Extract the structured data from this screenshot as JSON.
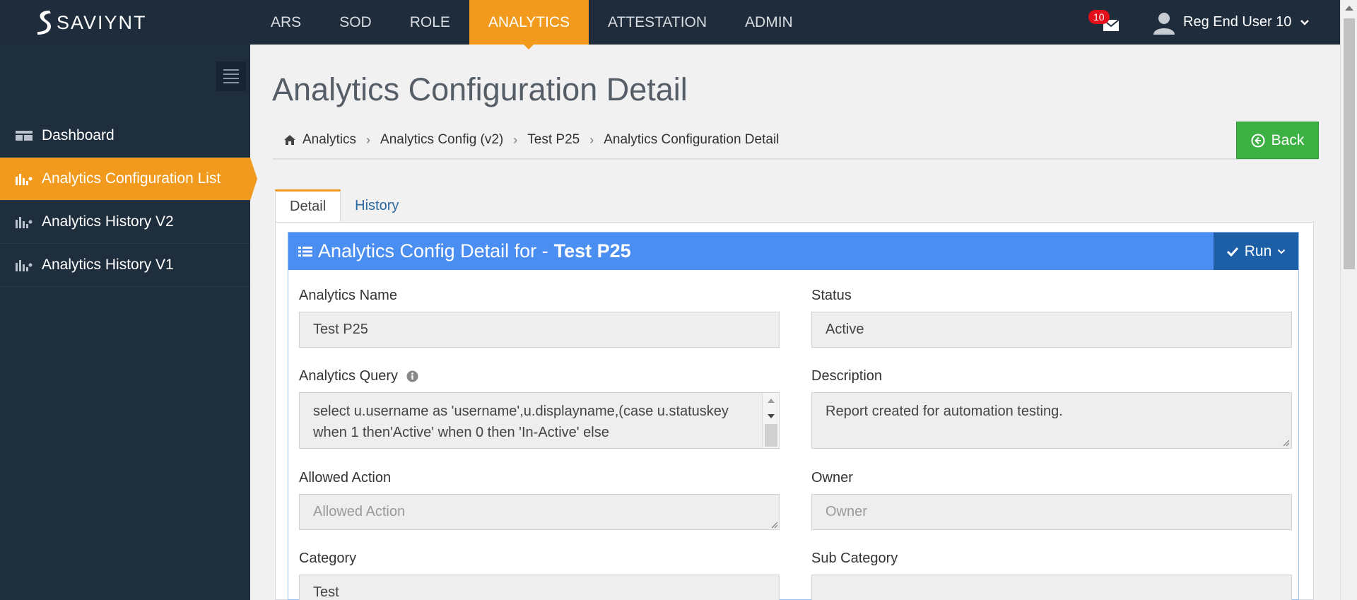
{
  "brand": {
    "name": "SAVIYNT"
  },
  "nav": {
    "items": [
      "ARS",
      "SOD",
      "ROLE",
      "ANALYTICS",
      "ATTESTATION",
      "ADMIN"
    ],
    "active": "ANALYTICS"
  },
  "notifications": {
    "count": "10"
  },
  "user": {
    "name": "Reg End User 10"
  },
  "sidebar": {
    "items": [
      {
        "label": "Dashboard",
        "icon": "dashboard-icon"
      },
      {
        "label": "Analytics Configuration List",
        "icon": "bar-chart-icon",
        "active": true
      },
      {
        "label": "Analytics History V2",
        "icon": "bar-chart-icon"
      },
      {
        "label": "Analytics History V1",
        "icon": "bar-chart-icon"
      }
    ]
  },
  "page": {
    "title": "Analytics Configuration Detail",
    "breadcrumb": [
      "Analytics",
      "Analytics Config (v2)",
      "Test P25",
      "Analytics Configuration Detail"
    ],
    "back_label": "Back"
  },
  "tabs": [
    "Detail",
    "History"
  ],
  "panel": {
    "title_prefix": "Analytics Config Detail for -",
    "title_name": "Test P25",
    "run_label": "Run"
  },
  "form": {
    "analytics_name": {
      "label": "Analytics Name",
      "value": "Test P25"
    },
    "status": {
      "label": "Status",
      "value": "Active"
    },
    "analytics_query": {
      "label": "Analytics Query",
      "value": "select u.username as 'username',u.displayname,(case u.statuskey when 1 then'Active' when 0 then 'In-Active' else"
    },
    "description": {
      "label": "Description",
      "value": "Report created for automation testing."
    },
    "allowed_action": {
      "label": "Allowed Action",
      "placeholder": "Allowed Action"
    },
    "owner": {
      "label": "Owner",
      "placeholder": "Owner"
    },
    "category": {
      "label": "Category",
      "value": "Test"
    },
    "sub_category": {
      "label": "Sub Category",
      "value": ""
    }
  },
  "colors": {
    "accent": "#f29a1e",
    "header_blue": "#4b8ef1",
    "run_blue": "#1c5fa6",
    "back_green": "#3cb043",
    "navbar": "#1e2c3b"
  }
}
